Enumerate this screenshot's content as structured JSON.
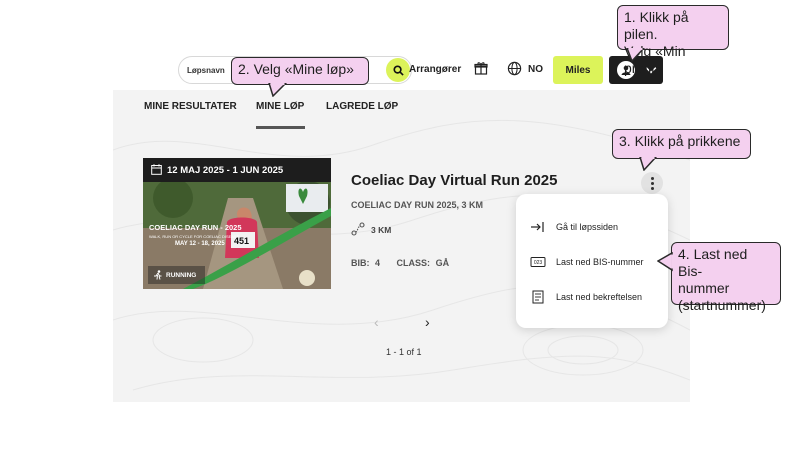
{
  "navbar": {
    "search_placeholder": "Løpsnavn",
    "organizers_label": "Arrangører",
    "language_label": "NO",
    "miles_label": "Miles",
    "icons": [
      "search-icon",
      "gift-icon",
      "globe-icon",
      "user-icon",
      "chevron-down-icon"
    ]
  },
  "tabs": [
    {
      "label": "MINE RESULTATER"
    },
    {
      "label": "MINE LØP"
    },
    {
      "label": "LAGREDE LØP"
    }
  ],
  "event": {
    "date_range": "12 MAJ 2025 - 1 JUN 2025",
    "title": "Coeliac Day Virtual Run 2025",
    "subtitle": "COELIAC DAY RUN 2025, 3 KM",
    "distance": "3 KM",
    "bib_label": "BIB:",
    "bib_value": "4",
    "class_label": "CLASS:",
    "class_value": "GÅ",
    "image": {
      "headline": "COELIAC DAY RUN - 2025",
      "tagline": "WALK, RUN OR CYCLE FOR COELIAC DISEASE",
      "dates": "MAY 12 - 18, 2025",
      "bib_number": "451",
      "badge": "RUNNING"
    }
  },
  "menu": {
    "items": [
      {
        "label": "Gå til løpssiden",
        "icon": "arrow-right-bar-icon"
      },
      {
        "label": "Last ned BIS-nummer",
        "icon": "number-tag-icon"
      },
      {
        "label": "Last ned bekreftelsen",
        "icon": "receipt-icon"
      }
    ]
  },
  "pagination": {
    "prev": "‹",
    "next": "›",
    "count": "1 - 1 of 1"
  },
  "callouts": {
    "c1_line1": "1. Klikk på pilen.",
    "c1_line2": "Velg «Min profil»",
    "c2": "2. Velg «Mine løp»",
    "c3": "3. Klikk på prikkene",
    "c4_line1": "4. Last ned Bis-",
    "c4_line2": "nummer",
    "c4_line3": "(startnummer)"
  },
  "colors": {
    "accent": "#dcf35a",
    "callout_bg": "#f4d0ef",
    "dark": "#1e1e1e"
  }
}
